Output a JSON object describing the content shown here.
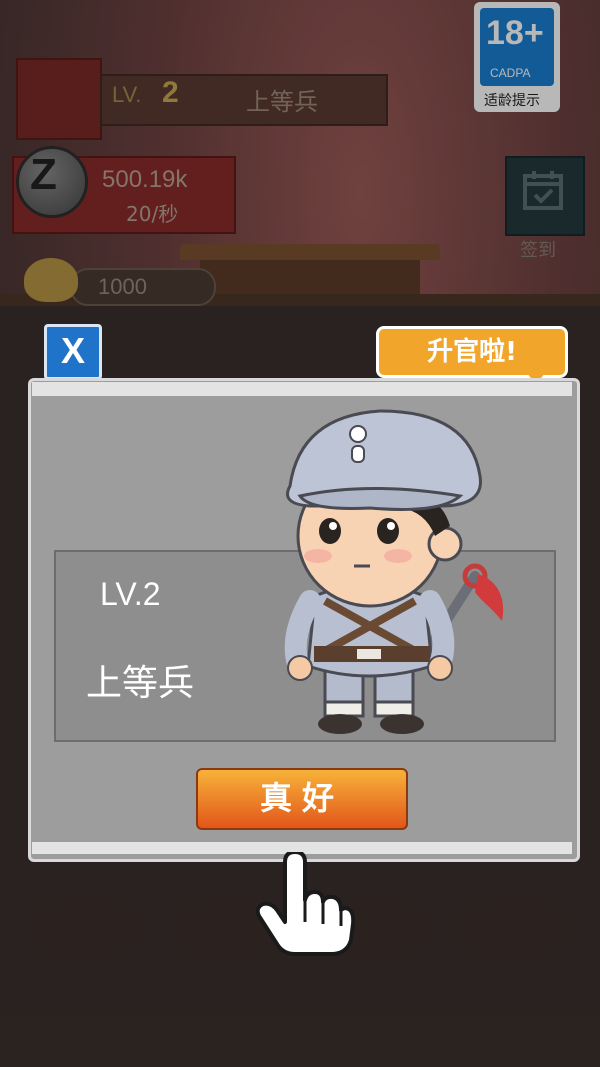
{
  "hud": {
    "level_label": "LV.",
    "level_number": "2",
    "rank": "上等兵",
    "coins": "500.19k",
    "coin_rate": "20/秒",
    "coin_glyph": "Z",
    "gold": "1000",
    "signin_label": "签到"
  },
  "age_badge": {
    "age": "18+",
    "org": "CADPA",
    "tip": "适龄提示"
  },
  "dialog": {
    "close_label": "X",
    "bubble": "升官啦!",
    "level": "LV.2",
    "rank": "上等兵",
    "confirm_label": "真好"
  },
  "icons": [
    "coin-icon",
    "gold-ingot-icon",
    "calendar-check-icon",
    "close-icon",
    "soldier-character",
    "hand-pointer-icon"
  ],
  "colors": {
    "confirm_top": "#f7b23a",
    "confirm_bottom": "#e2561a",
    "bubble": "#f1a52a",
    "close_blue": "#1f73c8",
    "cadpa_blue": "#1b7fd1"
  }
}
